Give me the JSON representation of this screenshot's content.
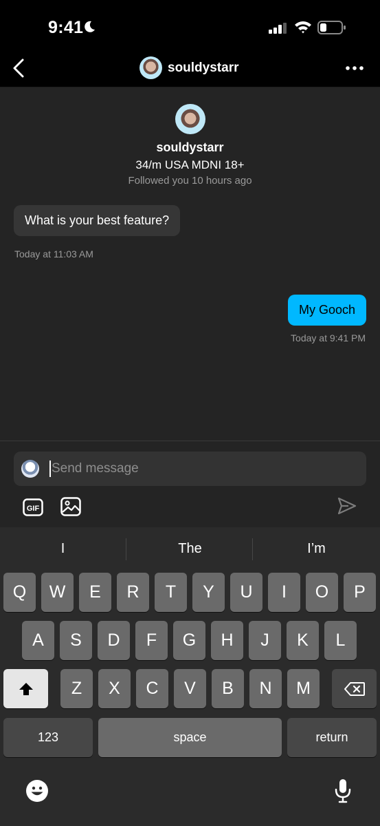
{
  "status_bar": {
    "time": "9:41"
  },
  "header": {
    "username": "souldystarr"
  },
  "profile": {
    "name": "souldystarr",
    "bio": "34/m USA MDNI 18+",
    "followed": "Followed you 10 hours ago"
  },
  "messages": [
    {
      "direction": "incoming",
      "text": "What is your best feature?",
      "time": "Today at 11:03 AM"
    },
    {
      "direction": "outgoing",
      "text": "My Gooch",
      "time": "Today at 9:41 PM"
    }
  ],
  "composer": {
    "placeholder": "Send message"
  },
  "keyboard": {
    "suggestions": [
      "I",
      "The",
      "I’m"
    ],
    "row1": [
      "Q",
      "W",
      "E",
      "R",
      "T",
      "Y",
      "U",
      "I",
      "O",
      "P"
    ],
    "row2": [
      "A",
      "S",
      "D",
      "F",
      "G",
      "H",
      "J",
      "K",
      "L"
    ],
    "row3": [
      "Z",
      "X",
      "C",
      "V",
      "B",
      "N",
      "M"
    ],
    "numbers_label": "123",
    "space_label": "space",
    "return_label": "return"
  },
  "colors": {
    "outgoing_bubble": "#00b8ff",
    "incoming_bubble": "#363636",
    "background": "#242424"
  }
}
